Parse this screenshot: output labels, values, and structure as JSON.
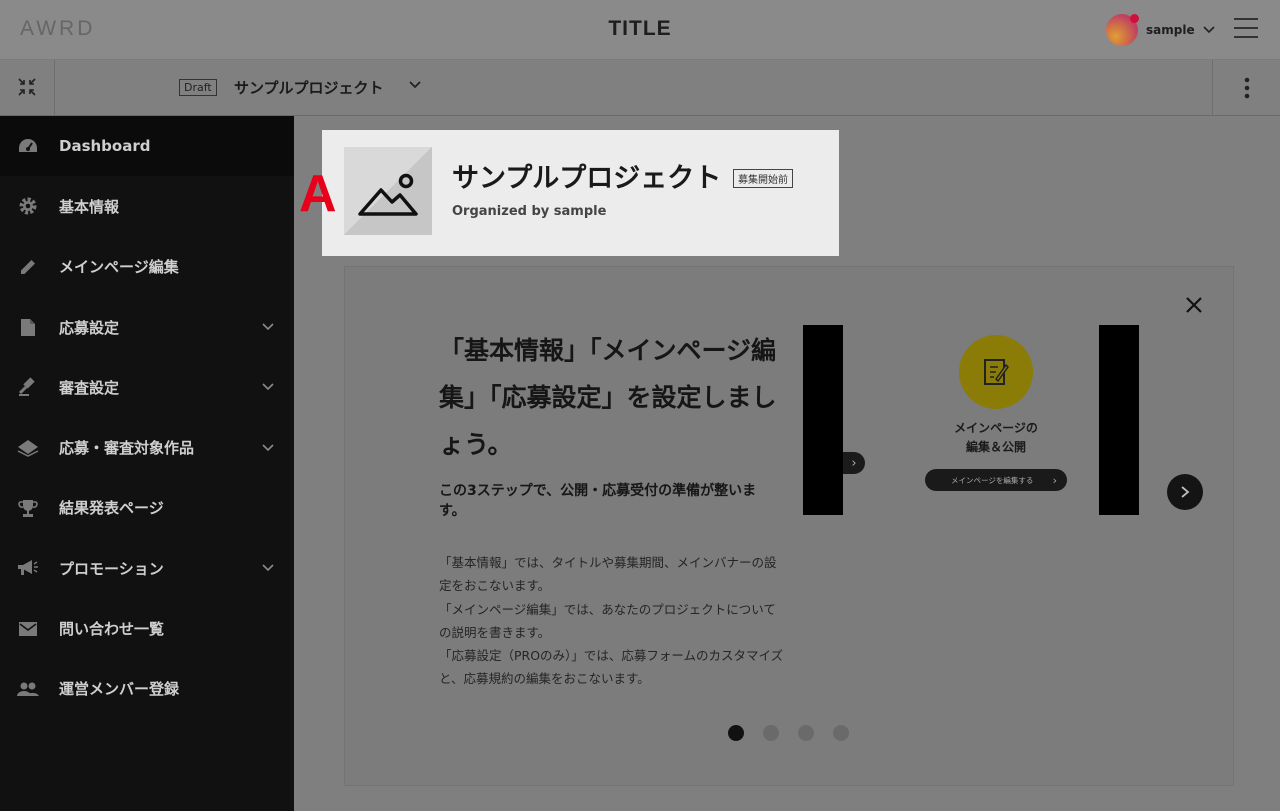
{
  "header": {
    "logo": "AWRD",
    "title": "TITLE",
    "user_name": "sample"
  },
  "subheader": {
    "draft_badge": "Draft",
    "project_name": "サンプルプロジェクト"
  },
  "sidebar": {
    "items": [
      {
        "label": "Dashboard",
        "icon": "dashboard-icon",
        "has_children": false,
        "active": true
      },
      {
        "label": "基本情報",
        "icon": "gear-icon",
        "has_children": false
      },
      {
        "label": "メインページ編集",
        "icon": "pencil-icon",
        "has_children": false
      },
      {
        "label": "応募設定",
        "icon": "document-icon",
        "has_children": true
      },
      {
        "label": "審査設定",
        "icon": "gavel-icon",
        "has_children": true
      },
      {
        "label": "応募・審査対象作品",
        "icon": "layers-icon",
        "has_children": true
      },
      {
        "label": "結果発表ページ",
        "icon": "trophy-icon",
        "has_children": false
      },
      {
        "label": "プロモーション",
        "icon": "megaphone-icon",
        "has_children": true
      },
      {
        "label": "問い合わせ一覧",
        "icon": "mail-icon",
        "has_children": false
      },
      {
        "label": "運営メンバー登録",
        "icon": "people-icon",
        "has_children": false
      }
    ]
  },
  "project_card": {
    "title": "サンプルプロジェクト",
    "status": "募集開始前",
    "organizer": "Organized by sample",
    "marker": "A"
  },
  "onboarding": {
    "heading_lines": [
      "「基本情報」「メインページ編",
      "集」「応募設定」を設定しまし",
      "ょう。"
    ],
    "subheading_lines": [
      "この3ステップで、公開・応募受付の準備が整いま",
      "す。"
    ],
    "body_lines": [
      "「基本情報」では、タイトルや募集期間、メインバナーの設",
      "定をおこないます。",
      "「メインページ編集」では、あなたのプロジェクトについて",
      "の説明を書きます。",
      "「応募設定（PROのみ）」では、応募フォームのカスタマイズ",
      "と、応募規約の編集をおこないます。"
    ],
    "slide": {
      "caption_lines": [
        "メインページの",
        "編集＆公開"
      ],
      "button_label": "メインページを編集する"
    },
    "pagination": {
      "total": 4,
      "current": 1
    }
  },
  "colors": {
    "accent_red": "#e8001b",
    "slide_circle": "#8a7c07",
    "sidebar_bg": "#111111"
  }
}
